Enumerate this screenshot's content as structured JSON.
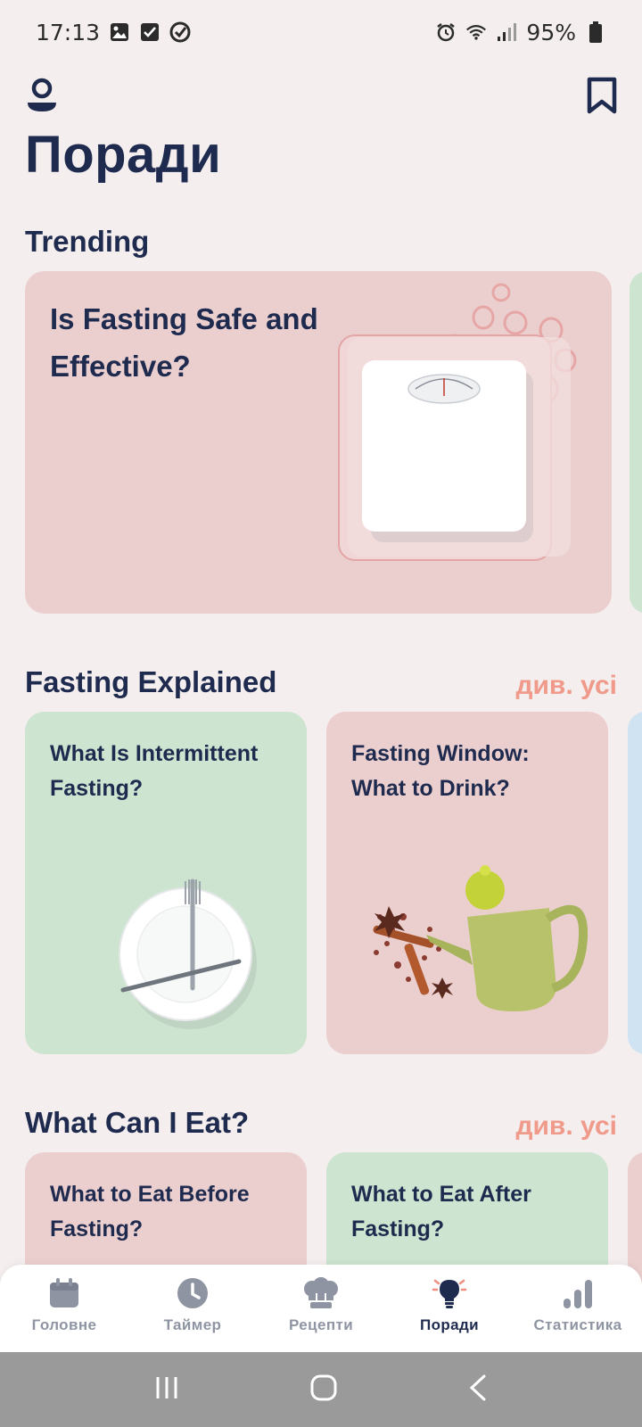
{
  "status": {
    "time": "17:13",
    "battery": "95%"
  },
  "page": {
    "title": "Поради"
  },
  "trending": {
    "title": "Trending",
    "card": {
      "title": "Is Fasting Safe and Effective?",
      "image": "bathroom-scale"
    }
  },
  "fasting_explained": {
    "title": "Fasting Explained",
    "see_all": "див. усі",
    "cards": [
      {
        "title": "What Is Intermittent Fasting?",
        "image": "plate-with-cutlery",
        "color": "#cde4d0"
      },
      {
        "title": "Fasting Window: What to Drink?",
        "image": "teapot-and-spices",
        "color": "#ebcfcf"
      }
    ]
  },
  "what_can_i_eat": {
    "title": "What Can I Eat?",
    "see_all": "див. усі",
    "cards": [
      {
        "title": "What to Eat Before Fasting?",
        "color": "#ebcfcf"
      },
      {
        "title": "What to Eat After Fasting?",
        "color": "#cde4d0"
      }
    ]
  },
  "nav": {
    "items": [
      {
        "label": "Головне",
        "icon": "calendar-icon"
      },
      {
        "label": "Таймер",
        "icon": "clock-icon"
      },
      {
        "label": "Рецепти",
        "icon": "chef-hat-icon"
      },
      {
        "label": "Поради",
        "icon": "lightbulb-icon",
        "active": true
      },
      {
        "label": "Статистика",
        "icon": "bar-chart-icon"
      }
    ]
  },
  "colors": {
    "background": "#f4eeee",
    "title": "#1e2a4e",
    "accent": "#ef9a8a",
    "pink_card": "#ebcfcf",
    "green_card": "#cde4d0"
  }
}
